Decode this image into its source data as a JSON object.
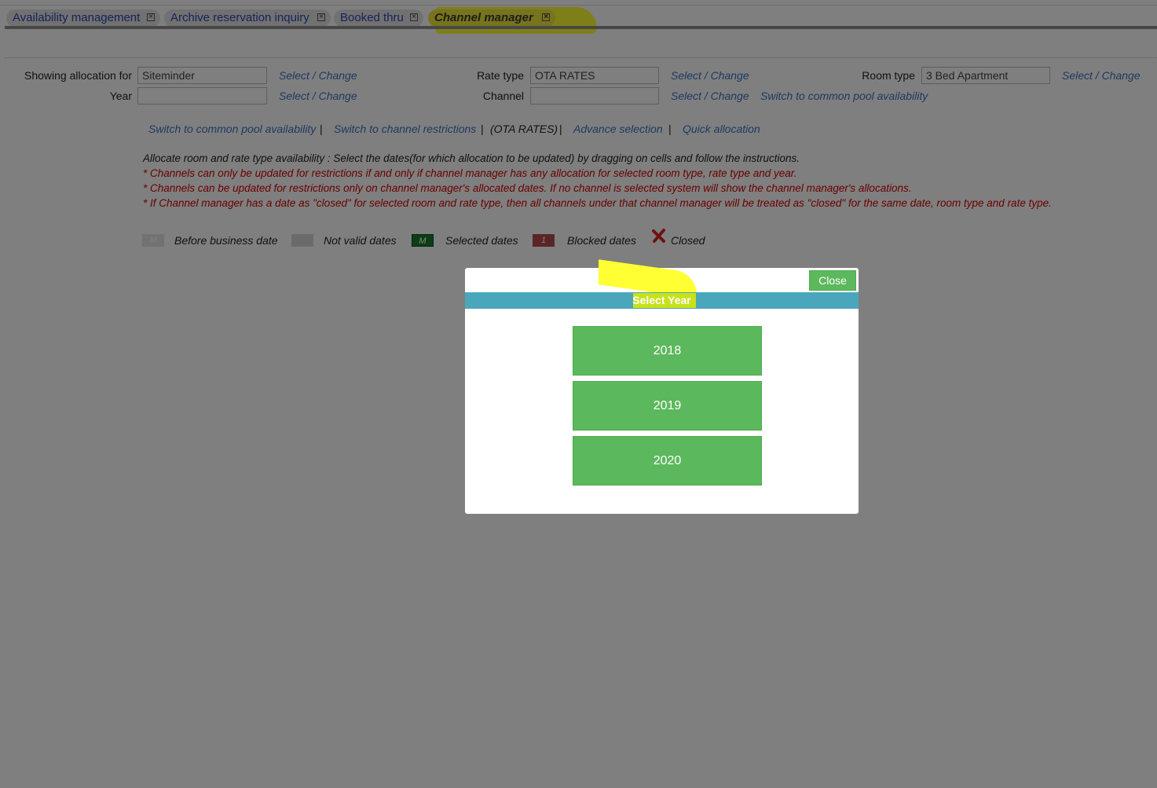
{
  "tabs": [
    {
      "label": "Availability management",
      "active": false
    },
    {
      "label": "Archive reservation inquiry",
      "active": false
    },
    {
      "label": "Booked thru",
      "active": false
    },
    {
      "label": "Channel manager",
      "active": true
    }
  ],
  "form": {
    "showing_label": "Showing allocation for",
    "showing_value": "Siteminder",
    "year_label": "Year",
    "year_value": "",
    "rate_type_label": "Rate type",
    "rate_type_value": "OTA RATES",
    "channel_label": "Channel",
    "channel_value": "",
    "room_type_label": "Room type",
    "room_type_value": "3 Bed Apartment",
    "select_change": "Select / Change",
    "switch_common_pool": "Switch to common pool availability"
  },
  "nav_links": {
    "common_pool": "Switch to common pool availability",
    "sep": "|",
    "channel_restrictions": "Switch to channel restrictions",
    "ota_rates": "(OTA RATES)",
    "advance_selection": "Advance selection",
    "quick_allocation": "Quick allocation"
  },
  "instructions": {
    "main": "Allocate room and rate type availability : Select the dates(for which allocation to be updated) by dragging on cells and follow the instructions.",
    "notes": [
      "* Channels can only be updated for restrictions if and only if channel manager has any allocation for selected room type, rate type and year.",
      "* Channels can be updated for restrictions only on channel manager's allocated dates. If no channel is selected system will show the channel manager's allocations.",
      "* If Channel manager has a date as \"closed\" for selected room and rate type, then all channels under that channel manager will be treated as \"closed\" for the same date, room type and rate type."
    ]
  },
  "legend": {
    "before_mark": "M",
    "before": "Before business date",
    "invalid": "Not valid dates",
    "selected_mark": "M",
    "selected": "Selected dates",
    "blocked_mark": "1",
    "blocked": "Blocked dates",
    "closed": "Closed"
  },
  "modal": {
    "close_label": "Close",
    "title": "Select Year",
    "years": [
      "2018",
      "2019",
      "2020"
    ]
  },
  "colors": {
    "accent_green": "#5cb85c",
    "header_teal": "#4aa6bb",
    "highlight_yellow": "#ffff33",
    "link_blue": "#3d72c0",
    "note_red": "#d60000"
  }
}
